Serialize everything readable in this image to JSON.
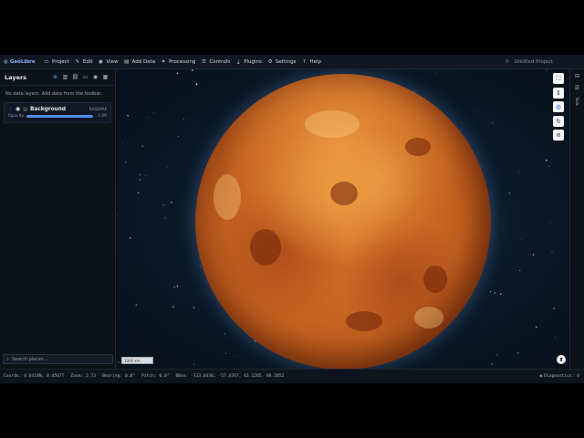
{
  "app": {
    "brand": "GeoLibre",
    "project_title": "Untitled Project"
  },
  "menu": [
    {
      "icon": "folder-icon",
      "glyph": "▭",
      "label": "Project"
    },
    {
      "icon": "pencil-icon",
      "glyph": "✎",
      "label": "Edit"
    },
    {
      "icon": "eye-icon",
      "glyph": "◉",
      "label": "View"
    },
    {
      "icon": "database-icon",
      "glyph": "▤",
      "label": "Add Data"
    },
    {
      "icon": "wrench-icon",
      "glyph": "✦",
      "label": "Processing"
    },
    {
      "icon": "sliders-icon",
      "glyph": "☰",
      "label": "Controls"
    },
    {
      "icon": "plug-icon",
      "glyph": "⏚",
      "label": "Plugins"
    },
    {
      "icon": "gear-icon",
      "glyph": "⚙",
      "label": "Settings"
    },
    {
      "icon": "help-icon",
      "glyph": "?",
      "label": "Help"
    }
  ],
  "sidebar": {
    "title": "Layers",
    "empty_message": "No data layers. Add data from the toolbar.",
    "layer": {
      "name": "Background",
      "badge": "BASEMAP",
      "opacity_label": "Opacity",
      "opacity_value": "1.00",
      "opacity_fraction": 1.0
    },
    "search_placeholder": "Search places..."
  },
  "map": {
    "scale_text": "1000 km"
  },
  "right_rail": {
    "label": "Tools"
  },
  "status": {
    "coords": "Coords: 4.6418N, 0.4567T",
    "zoom": "Zoom: 2.73",
    "bearing": "Bearing: 0.0°",
    "pitch": "Pitch: 0.0°",
    "bbox": "BBox: -113.0336, -57.4767, 43.1285, 86.2852",
    "diagnostics": "Diagnostics: 0"
  }
}
